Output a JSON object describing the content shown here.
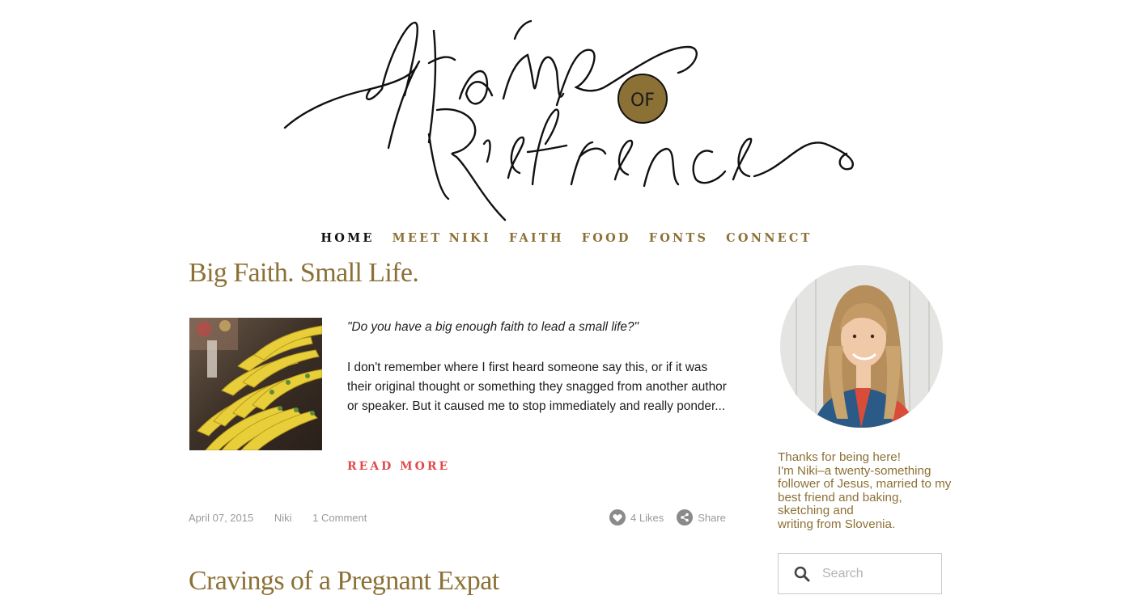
{
  "colors": {
    "accent_gold": "#8c7136",
    "read_more_red": "#e04a4a",
    "meta_gray": "#9a9a9a",
    "logo_ink": "#111111",
    "logo_badge": "#8c7136"
  },
  "logo": {
    "alt": "Frame of Reference",
    "line1": "frame",
    "badge": "OF",
    "line2": "Reference"
  },
  "nav": {
    "items": [
      {
        "label": "HOME",
        "active": true
      },
      {
        "label": "MEET NIKI",
        "active": false
      },
      {
        "label": "FAITH",
        "active": false
      },
      {
        "label": "FOOD",
        "active": false
      },
      {
        "label": "FONTS",
        "active": false
      },
      {
        "label": "CONNECT",
        "active": false
      }
    ]
  },
  "posts": [
    {
      "title": "Big Faith. Small Life.",
      "quote": "\"Do you have a big enough faith to lead a small life?\"",
      "excerpt": "I don't remember where I first heard someone say this, or if it was their original thought or something they snagged from another author or speaker. But it caused me to stop immediately and really ponder...",
      "read_more": "READ MORE",
      "date": "April 07, 2015",
      "author": "Niki",
      "comments": "1 Comment",
      "likes": "4 Likes",
      "share": "Share",
      "image_icon": "banana-photo"
    },
    {
      "title": "Cravings of a Pregnant Expat"
    }
  ],
  "sidebar": {
    "avatar_icon": "author-portrait",
    "bio": [
      "Thanks for being here!",
      "I'm Niki–a twenty-something follower of Jesus, married to my best friend and baking, sketching and",
      "writing from Slovenia."
    ],
    "search": {
      "placeholder": "Search",
      "icon": "search-icon"
    }
  }
}
